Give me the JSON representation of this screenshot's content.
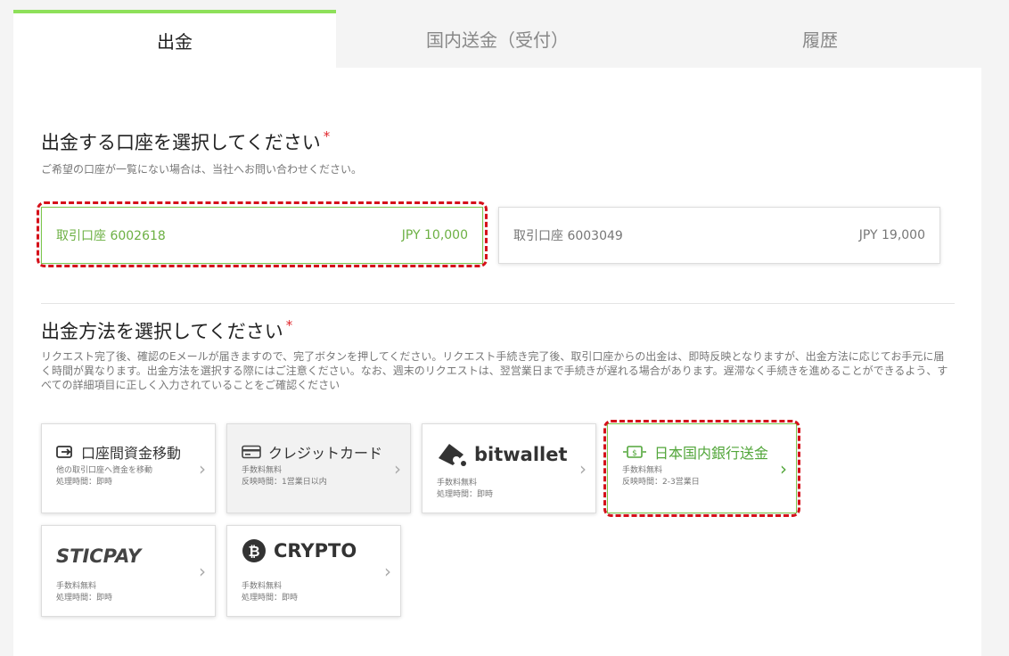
{
  "tabs": [
    {
      "label": "出金"
    },
    {
      "label": "国内送金（受付）"
    },
    {
      "label": "履歴"
    }
  ],
  "account_section": {
    "title": "出金する口座を選択してください",
    "required": "*",
    "subtitle": "ご希望の口座が一覧にない場合は、当社へお問い合わせください。",
    "accounts": [
      {
        "name": "取引口座 6002618",
        "balance": "JPY 10,000"
      },
      {
        "name": "取引口座 6003049",
        "balance": "JPY 19,000"
      }
    ]
  },
  "method_section": {
    "title": "出金方法を選択してください",
    "required": "*",
    "description": "リクエスト完了後、確認のEメールが届きますので、完了ボタンを押してください。リクエスト手続き完了後、取引口座からの出金は、即時反映となりますが、出金方法に応じてお手元に届く時間が異なります。出金方法を選択する際にはご注意ください。なお、週末のリクエストは、翌営業日まで手続きが遅れる場合があります。遅滞なく手続きを進めることができるよう、すべての詳細項目に正しく入力されていることをご確認ください",
    "methods": [
      {
        "title": "口座間資金移動",
        "icon": "transfer-icon",
        "line1": "他の取引口座へ資金を移動",
        "line2": "処理時間：即時"
      },
      {
        "title": "クレジットカード",
        "icon": "credit-card-icon",
        "line1": "手数料無料",
        "line2": "反映時間：1営業日以内"
      },
      {
        "title": "bitwallet",
        "icon": "bitwallet-logo",
        "line1": "手数料無料",
        "line2": "処理時間：即時"
      },
      {
        "title": "日本国内銀行送金",
        "icon": "bank-transfer-icon",
        "line1": "手数料無料",
        "line2": "反映時間：2-3営業日"
      },
      {
        "title": "STICPAY",
        "icon": "sticpay-logo",
        "line1": "手数料無料",
        "line2": "処理時間：即時"
      },
      {
        "title": "CRYPTO",
        "icon": "bitcoin-icon",
        "line1": "手数料無料",
        "line2": "処理時間：即時"
      }
    ]
  },
  "chevron": "›",
  "bitcoin_symbol": "₿",
  "colors": {
    "accent": "#8ee05a",
    "selected": "#6cb043",
    "highlight": "#d5101a"
  }
}
